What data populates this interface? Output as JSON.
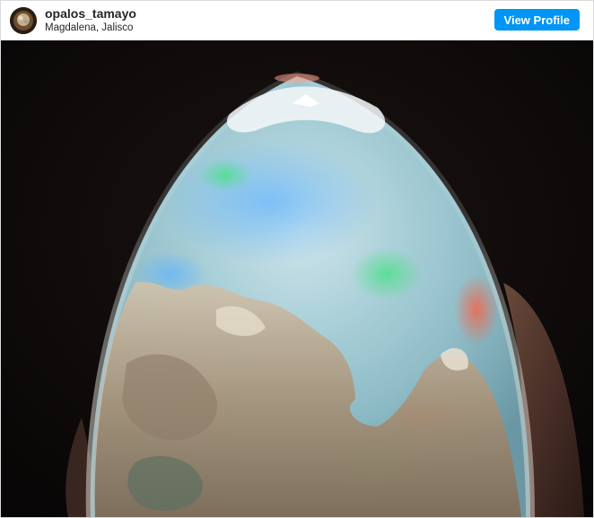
{
  "post": {
    "username": "opalos_tamayo",
    "location": "Magdalena, Jalisco",
    "view_profile_label": "View Profile"
  },
  "icons": {
    "avatar": "profile-picture"
  },
  "colors": {
    "button": "#0095f6",
    "photo_background": "#0b0807"
  }
}
